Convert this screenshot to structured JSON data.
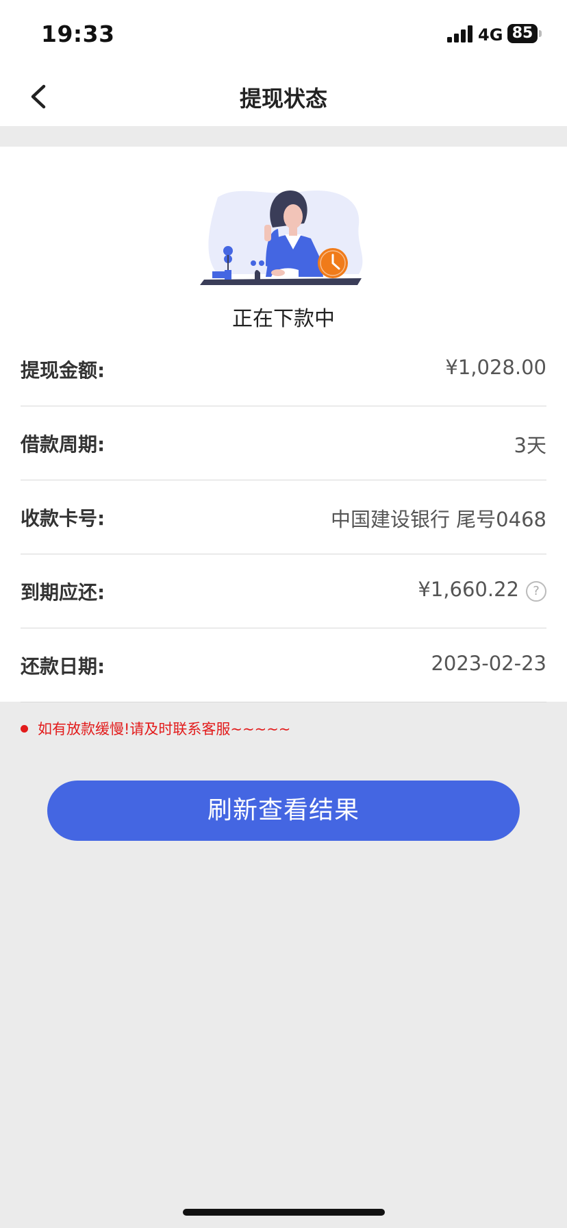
{
  "status_bar": {
    "time": "19:33",
    "network": "4G",
    "battery": "85"
  },
  "nav": {
    "title": "提现状态"
  },
  "status": {
    "text": "正在下款中"
  },
  "details": [
    {
      "label": "提现金额:",
      "value": "¥1,028.00"
    },
    {
      "label": "借款周期:",
      "value": "3天"
    },
    {
      "label": "收款卡号:",
      "value": "中国建设银行 尾号0468"
    },
    {
      "label": "到期应还:",
      "value": "¥1,660.22",
      "help": "?"
    },
    {
      "label": "还款日期:",
      "value": "2023-02-23"
    }
  ],
  "notice": "如有放款缓慢!请及时联系客服~~~~~",
  "button": {
    "label": "刷新查看结果"
  },
  "colors": {
    "accent": "#4466e2",
    "notice": "#e21b1b",
    "clock": "#f07b1a"
  }
}
